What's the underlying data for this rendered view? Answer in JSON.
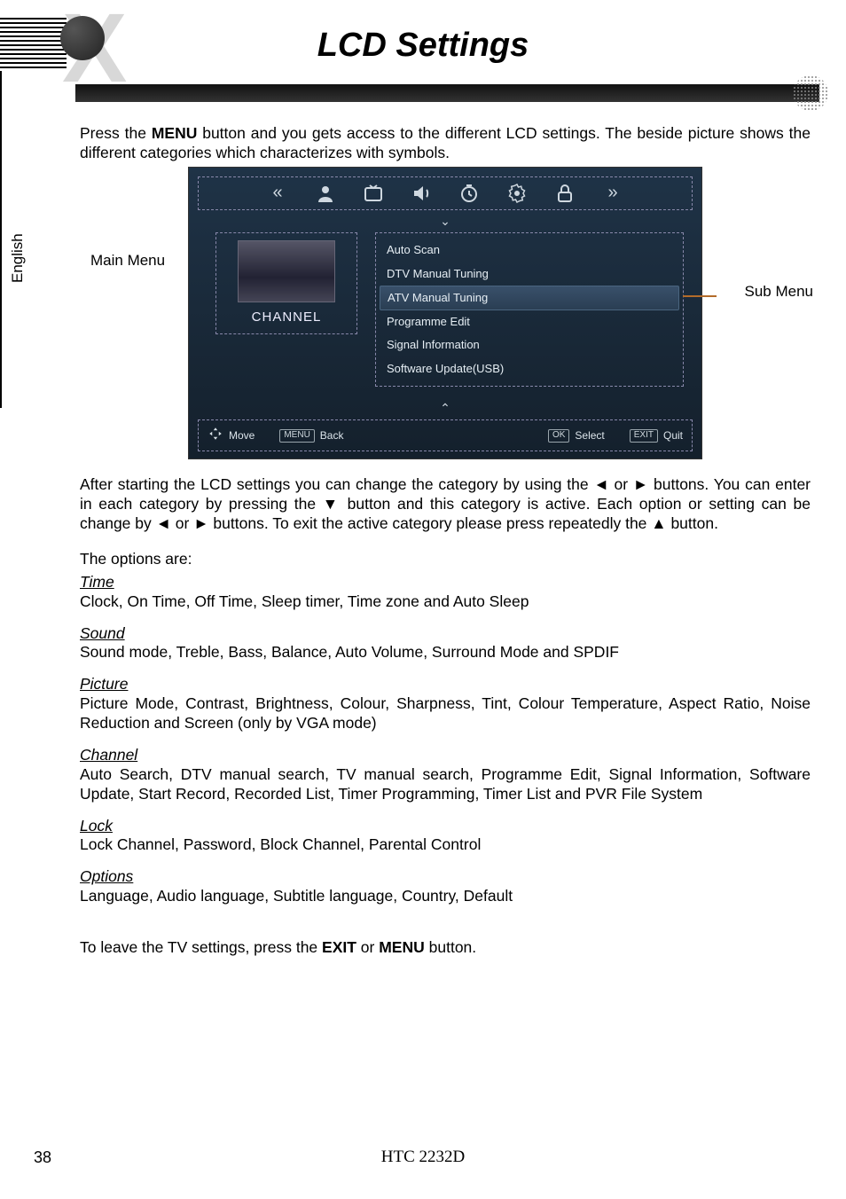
{
  "page": {
    "title": "LCD Settings",
    "language_tab": "English",
    "page_number": "38",
    "model": "HTC 2232D"
  },
  "intro": "Press the MENU button and you gets access to the different LCD settings. The beside picture shows the different categories which characterizes with symbols.",
  "intro_bold_word": "MENU",
  "osd": {
    "main_label": "Main Menu",
    "sub_label": "Sub Menu",
    "category_label": "CHANNEL",
    "items": [
      "Auto Scan",
      "DTV Manual Tuning",
      "ATV Manual Tuning",
      "Programme Edit",
      "Signal Information",
      "Software Update(USB)"
    ],
    "selected_index": 2,
    "footer": {
      "move": "Move",
      "back_key": "MENU",
      "back": "Back",
      "select_key": "OK",
      "select": "Select",
      "quit_key": "EXIT",
      "quit": "Quit"
    }
  },
  "after_osd": "After starting the LCD settings you can change the category by using the ◄ or ► buttons. You can enter in each category by pressing the ▼ button and this category is active. Each option or setting can be change by ◄ or ► buttons. To exit the active category please press repeatedly the ▲ button.",
  "options_intro": "The options are:",
  "sections": [
    {
      "head": "Time",
      "body": "Clock, On Time, Off Time, Sleep timer, Time zone and Auto Sleep"
    },
    {
      "head": "Sound",
      "body": "Sound mode, Treble, Bass, Balance, Auto Volume, Surround Mode and SPDIF"
    },
    {
      "head": "Picture",
      "body": "Picture Mode, Contrast, Brightness, Colour, Sharpness, Tint, Colour Temperature, Aspect Ratio, Noise Reduction and Screen (only by VGA mode)"
    },
    {
      "head": "Channel",
      "body": "Auto Search, DTV manual search, TV manual search, Programme Edit, Signal Information, Software Update, Start Record, Recorded List, Timer Programming, Timer List and PVR File System"
    },
    {
      "head": "Lock",
      "body": "Lock Channel, Password, Block Channel, Parental Control"
    },
    {
      "head": "Options",
      "body": "Language, Audio language, Subtitle language, Country, Default"
    }
  ],
  "closing": {
    "prefix": "To leave the TV settings, press the ",
    "b1": "EXIT",
    "mid": " or ",
    "b2": "MENU",
    "suffix": " button."
  }
}
